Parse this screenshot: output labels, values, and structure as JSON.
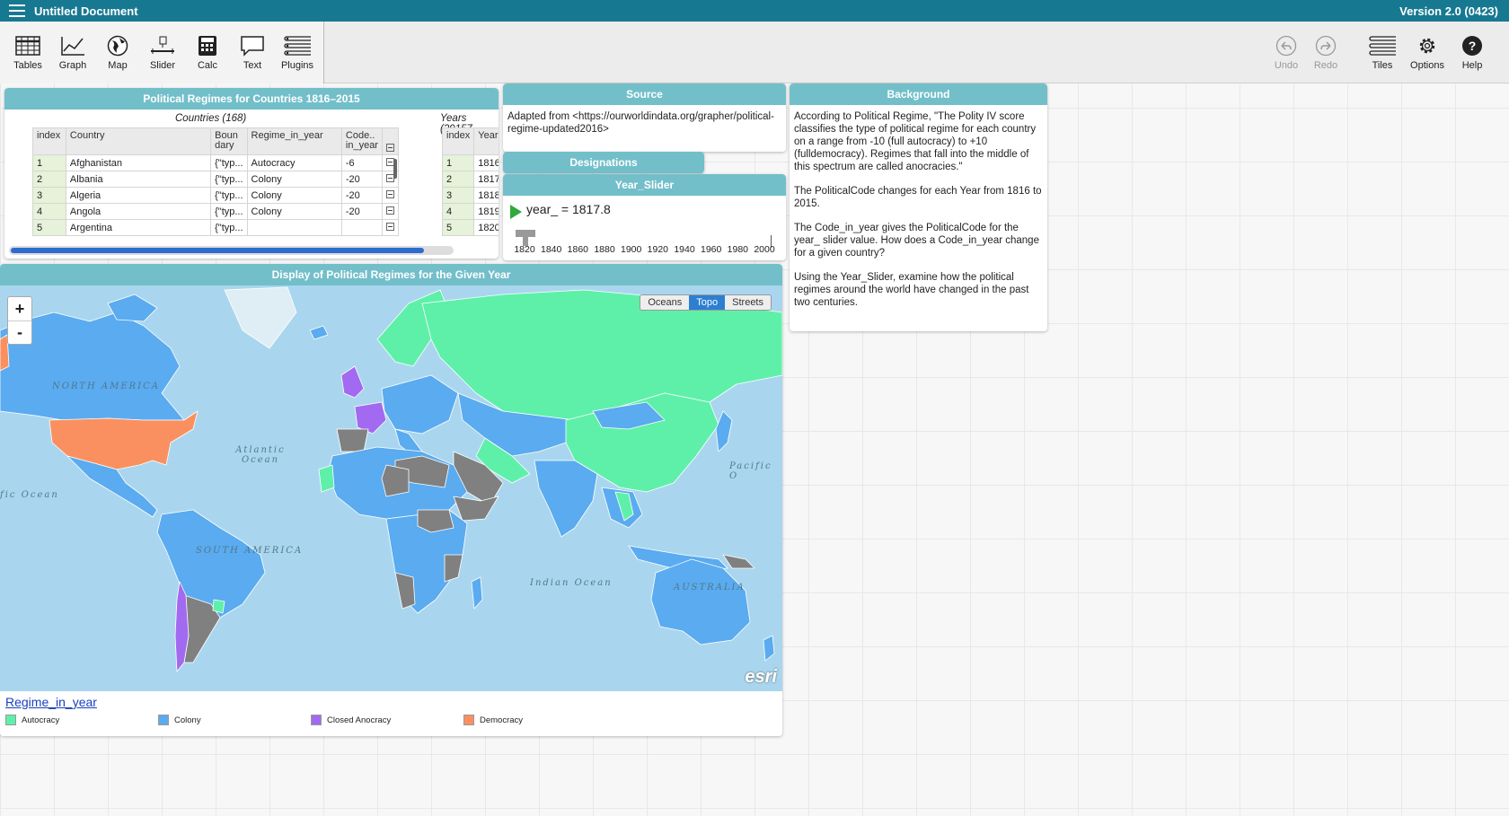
{
  "titlebar": {
    "doc_title": "Untitled Document",
    "version": "Version 2.0 (0423)"
  },
  "toolbar": {
    "left_tools": [
      "Tables",
      "Graph",
      "Map",
      "Slider",
      "Calc",
      "Text",
      "Plugins"
    ],
    "right_tools": [
      "Undo",
      "Redo",
      "Tiles",
      "Options",
      "Help"
    ]
  },
  "table": {
    "title": "Political Regimes for Countries 1816–2015",
    "countries_title": "Countries (168)",
    "years_title": "Years (29157",
    "headers": {
      "index": "index",
      "country": "Country",
      "boundary": "Boun dary",
      "regime": "Regime_in_year",
      "code": "Code.. in_year",
      "year": "Year"
    },
    "rows": [
      {
        "index": "1",
        "country": "Afghanistan",
        "boundary": "{\"typ...",
        "regime": "Autocracy",
        "code": "-6",
        "yidx": "1",
        "year": "1816"
      },
      {
        "index": "2",
        "country": "Albania",
        "boundary": "{\"typ...",
        "regime": "Colony",
        "code": "-20",
        "yidx": "2",
        "year": "1817"
      },
      {
        "index": "3",
        "country": "Algeria",
        "boundary": "{\"typ...",
        "regime": "Colony",
        "code": "-20",
        "yidx": "3",
        "year": "1818"
      },
      {
        "index": "4",
        "country": "Angola",
        "boundary": "{\"typ...",
        "regime": "Colony",
        "code": "-20",
        "yidx": "4",
        "year": "1819"
      },
      {
        "index": "5",
        "country": "Argentina",
        "boundary": "{\"typ...",
        "regime": "",
        "code": "",
        "yidx": "5",
        "year": "1820"
      }
    ]
  },
  "source": {
    "title": "Source",
    "text": "Adapted from <https://ourworldindata.org/grapher/political-regime-updated2016>"
  },
  "designations": {
    "title": "Designations"
  },
  "slider": {
    "title": "Year_Slider",
    "label": "year_ = 1817.8",
    "value": 1817.8,
    "min": 1820,
    "max": 2000,
    "ticks": [
      "1820",
      "1840",
      "1860",
      "1880",
      "1900",
      "1920",
      "1940",
      "1960",
      "1980",
      "2000"
    ]
  },
  "background": {
    "title": "Background",
    "paragraphs": [
      "According to Political Regime, \"The Polity IV score classifies the type of political regime for each country on a range from -10 (full autocracy) to +10 (fulldemocracy). Regimes that fall into the middle of this spectrum are called anocracies.\"",
      "The PoliticalCode changes for each Year from 1816 to 2015.",
      "The Code_in_year gives the PoliticalCode for the year_ slider value. How does a Code_in_year change for a given country?",
      "Using the Year_Slider, examine how the political regimes around the world have changed in the past two centuries."
    ]
  },
  "map": {
    "title": "Display of Political Regimes for the Given Year",
    "zoom_in": "+",
    "zoom_out": "-",
    "basemaps": [
      "Oceans",
      "Topo",
      "Streets"
    ],
    "active_basemap": "Topo",
    "labels": {
      "north_america": "NORTH AMERICA",
      "atlantic": "Atlantic Ocean",
      "pacific_left": "fic Ocean",
      "pacific_right": "Pacific O",
      "indian": "Indian Ocean",
      "south_america": "SOUTH AMERICA",
      "australia": "AUSTRALIA"
    },
    "attribution": "esri",
    "legend_title": "Regime_in_year",
    "legend": [
      {
        "label": "Autocracy",
        "color": "#5ef0a9"
      },
      {
        "label": "Colony",
        "color": "#5aabf0"
      },
      {
        "label": "Closed Anocracy",
        "color": "#a26af0"
      },
      {
        "label": "Democracy",
        "color": "#fa9060"
      }
    ],
    "other_color": "#808080"
  }
}
